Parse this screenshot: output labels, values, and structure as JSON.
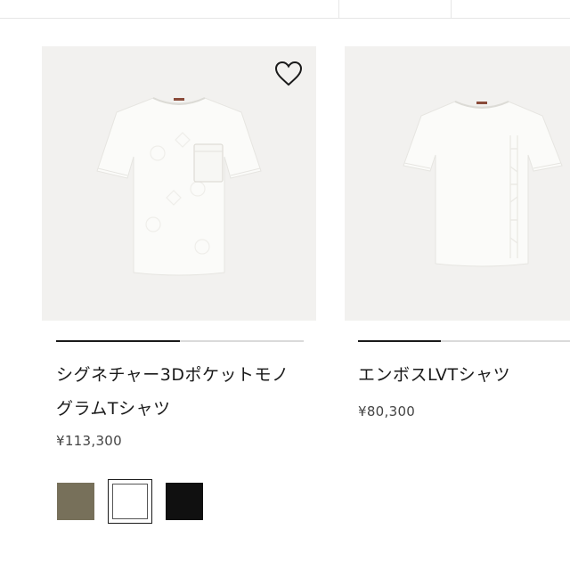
{
  "products": [
    {
      "name": "シグネチャー3DポケットモノグラムTシャツ",
      "name_line1": "シグネチャー3Dポケットモノ",
      "name_line2": "グラムTシャツ",
      "price": "¥113,300",
      "image_progress": 0.5,
      "wishlist_icon": "heart-outline-icon",
      "swatches": [
        {
          "name": "khaki",
          "color": "#77705a",
          "selected": false
        },
        {
          "name": "white",
          "color": "#ffffff",
          "selected": true
        },
        {
          "name": "black",
          "color": "#101010",
          "selected": false
        }
      ]
    },
    {
      "name": "エンボスLVTシャツ",
      "price": "¥80,300",
      "image_progress": 0.39
    }
  ],
  "colors": {
    "image_background": "#f2f1ef",
    "text": "#1a1a1a",
    "progress_track": "#dadada",
    "progress_fill": "#1a1a1a"
  }
}
